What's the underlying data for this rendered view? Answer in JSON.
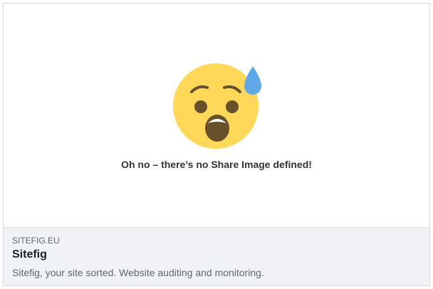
{
  "preview": {
    "emoji_icon": "anxious-face-with-sweat-icon",
    "message": "Oh no – there’s no Share Image defined!",
    "colors": {
      "face": "#FFD859",
      "features": "#66512B",
      "sweat": "#5FA8E8",
      "footer_bg": "#F0F2F5",
      "border": "#DADDE1"
    }
  },
  "link": {
    "domain": "SITEFIG.EU",
    "title": "Sitefig",
    "description": "Sitefig, your site sorted. Website auditing and monitoring."
  }
}
